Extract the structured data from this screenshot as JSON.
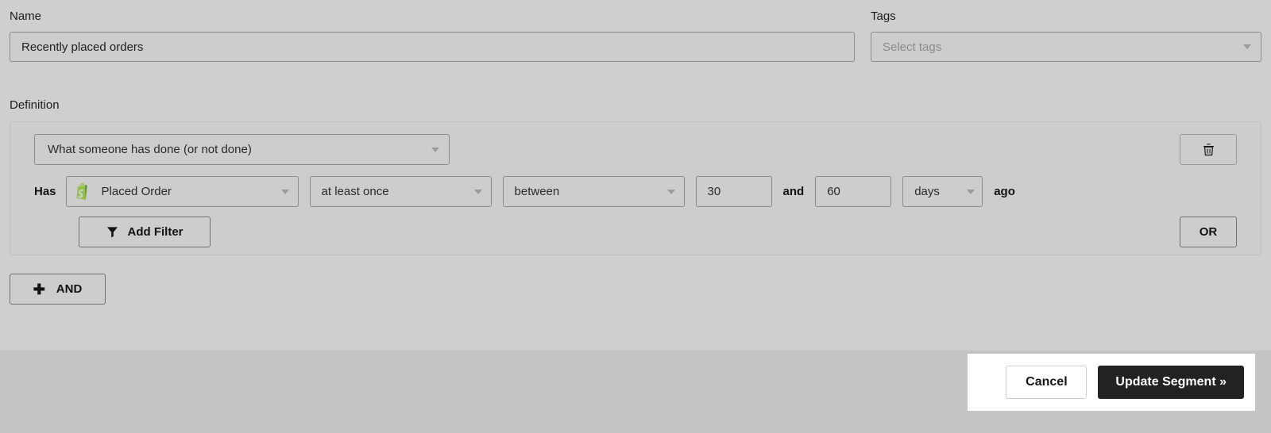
{
  "form": {
    "name": {
      "label": "Name",
      "value": "Recently placed orders",
      "placeholder": "Name"
    },
    "tags": {
      "label": "Tags",
      "placeholder": "Select tags",
      "value": ""
    }
  },
  "definition": {
    "label": "Definition",
    "trigger": {
      "value": "What someone has done (or not done)"
    },
    "filter_row": {
      "prefix_label": "Has",
      "metric": {
        "icon": "shopify-icon",
        "value": "Placed Order"
      },
      "frequency": {
        "value": "at least once"
      },
      "range_operator": {
        "value": "between"
      },
      "value_from": "30",
      "conjunction": "and",
      "value_to": "60",
      "unit": {
        "value": "days"
      },
      "suffix": "ago"
    },
    "add_filter_label": "Add Filter",
    "add_filter_icon": "funnel-icon",
    "delete_icon": "trash-icon",
    "or_label": "OR"
  },
  "group": {
    "and_label": "AND",
    "and_icon": "plus-icon"
  },
  "footer": {
    "cancel_label": "Cancel",
    "submit_label": "Update Segment »"
  },
  "colors": {
    "page_background": "#cfcfcf",
    "footer_background": "#c4c4c4",
    "panel_background": "#ffffff",
    "primary_button": "#222222",
    "shopify_green": "#95bf47",
    "shopify_green_dark": "#5e8e3e",
    "border": "#8c8c8c"
  }
}
